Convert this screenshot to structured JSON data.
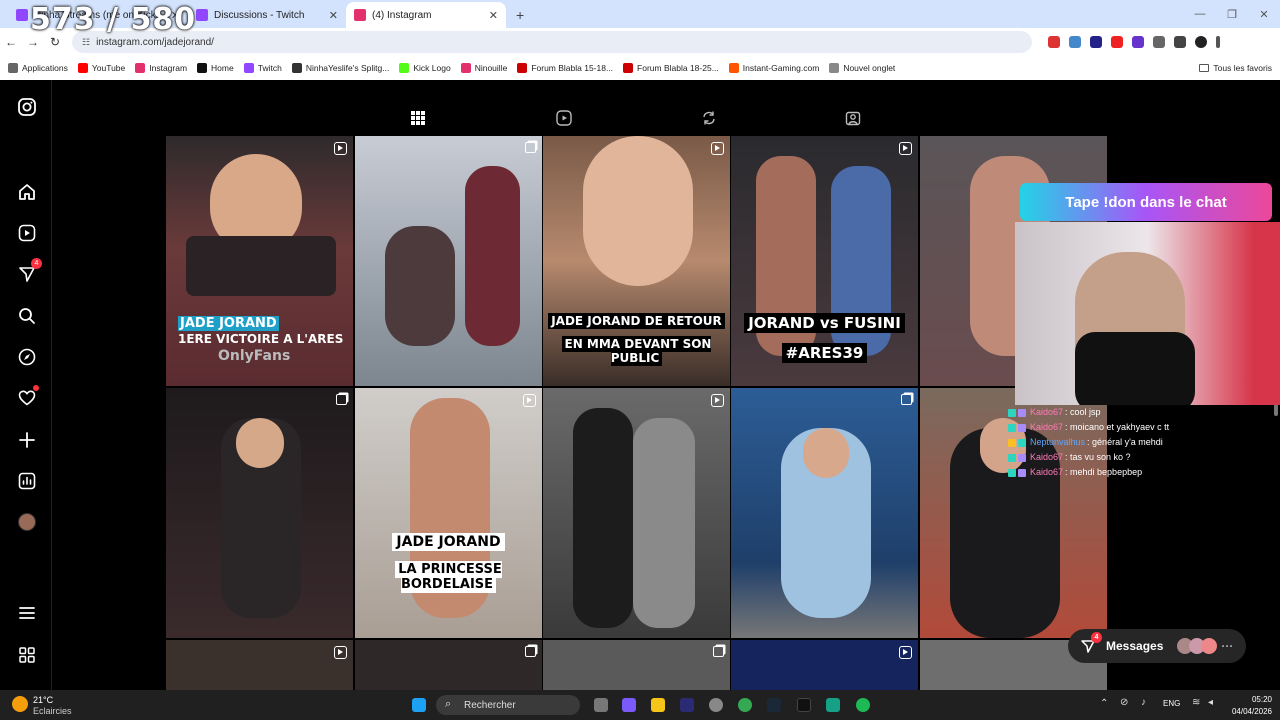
{
  "browser": {
    "counter": "573 / 580",
    "tabs": [
      {
        "title": "Ninha Streams (me on Kick)",
        "color": "#9146ff",
        "active": false
      },
      {
        "title": "Discussions - Twitch",
        "color": "#9146ff",
        "active": false
      },
      {
        "title": "(4) Instagram",
        "color": "#e1306c",
        "active": true
      }
    ],
    "url": "instagram.com/jadejorand/",
    "bookmarks": [
      {
        "label": "Applications",
        "color": "#666"
      },
      {
        "label": "YouTube",
        "color": "#ff0000"
      },
      {
        "label": "Instagram",
        "color": "#e1306c"
      },
      {
        "label": "Home",
        "color": "#111"
      },
      {
        "label": "Twitch",
        "color": "#9146ff"
      },
      {
        "label": "NinhaYeslife's Splitg...",
        "color": "#333"
      },
      {
        "label": "Kick Logo",
        "color": "#53fc18"
      },
      {
        "label": "Ninouille",
        "color": "#e1306c"
      },
      {
        "label": "Forum Blabla 15-18...",
        "color": "#c00"
      },
      {
        "label": "Forum Blabla 18-25...",
        "color": "#c00"
      },
      {
        "label": "Instant-Gaming.com",
        "color": "#ff5400"
      },
      {
        "label": "Nouvel onglet",
        "color": "#888"
      }
    ],
    "bookmarks_right": "Tous les favoris"
  },
  "sidebar": {
    "badge_count": "4",
    "items": [
      "instagram-logo",
      "home",
      "reels",
      "messages",
      "search",
      "explore",
      "notifications",
      "create",
      "dashboard",
      "profile",
      "more",
      "also-from-meta"
    ]
  },
  "posts": [
    {
      "overlay_lines": [
        "JADE JORAND",
        "1ERE VICTOIRE A L'ARES"
      ],
      "watermark": "OnlyFans",
      "type": "reel",
      "bg": "#5a2b30"
    },
    {
      "overlay_lines": [],
      "watermark": "",
      "type": "multi",
      "bg": "#a8adb6"
    },
    {
      "overlay_lines": [
        "JADE JORAND DE RETOUR",
        "EN MMA DEVANT SON PUBLIC"
      ],
      "watermark": "",
      "type": "reel",
      "bg": "#6b4a3a"
    },
    {
      "overlay_lines": [
        "JORAND vs FUSINI",
        "#ARES39"
      ],
      "watermark": "",
      "type": "reel",
      "bg": "#3a3438"
    },
    {
      "overlay_lines": [],
      "watermark": "",
      "type": "none",
      "bg": "#4a4446"
    },
    {
      "overlay_lines": [],
      "watermark": "",
      "type": "multi",
      "bg": "#2a2425"
    },
    {
      "overlay_lines": [
        "JADE JORAND",
        "LA PRINCESSE BORDELAISE"
      ],
      "watermark": "",
      "type": "reel",
      "bg": "#6a4034"
    },
    {
      "overlay_lines": [],
      "watermark": "",
      "type": "reel",
      "bg": "#555"
    },
    {
      "overlay_lines": [],
      "watermark": "",
      "type": "multi",
      "bg": "#2f5a8a"
    },
    {
      "overlay_lines": [],
      "watermark": "",
      "type": "none",
      "bg": "#6a5548"
    },
    {
      "overlay_lines": [],
      "watermark": "",
      "type": "reel",
      "bg": "#222"
    },
    {
      "overlay_lines": [],
      "watermark": "",
      "type": "multi",
      "bg": "#3a3030"
    },
    {
      "overlay_lines": [],
      "watermark": "",
      "type": "multi",
      "bg": "#555"
    },
    {
      "overlay_lines": [],
      "watermark": "",
      "type": "reel",
      "bg": "#1a2a6a"
    },
    {
      "overlay_lines": [],
      "watermark": "",
      "type": "none",
      "bg": "#777"
    }
  ],
  "stream": {
    "banner": "Tape !don dans le chat",
    "chat": [
      {
        "user": "Kaido67",
        "text": ": cool jsp"
      },
      {
        "user": "Kaido67",
        "text": ": moicano et yakhyaev c tt"
      },
      {
        "user": "Neptunvalhus",
        "text": ": général y'a mehdi"
      },
      {
        "user": "Kaido67",
        "text": ": tas vu son ko ?"
      },
      {
        "user": "Kaido67",
        "text": ": mehdi bepbepbep"
      }
    ]
  },
  "messages_label": "Messages",
  "messages_badge": "4",
  "taskbar": {
    "weather_temp": "21°C",
    "weather_desc": "Eclaircies",
    "search": "Rechercher",
    "lang": "ENG",
    "time": "05:20",
    "date": "04/04/2026"
  }
}
